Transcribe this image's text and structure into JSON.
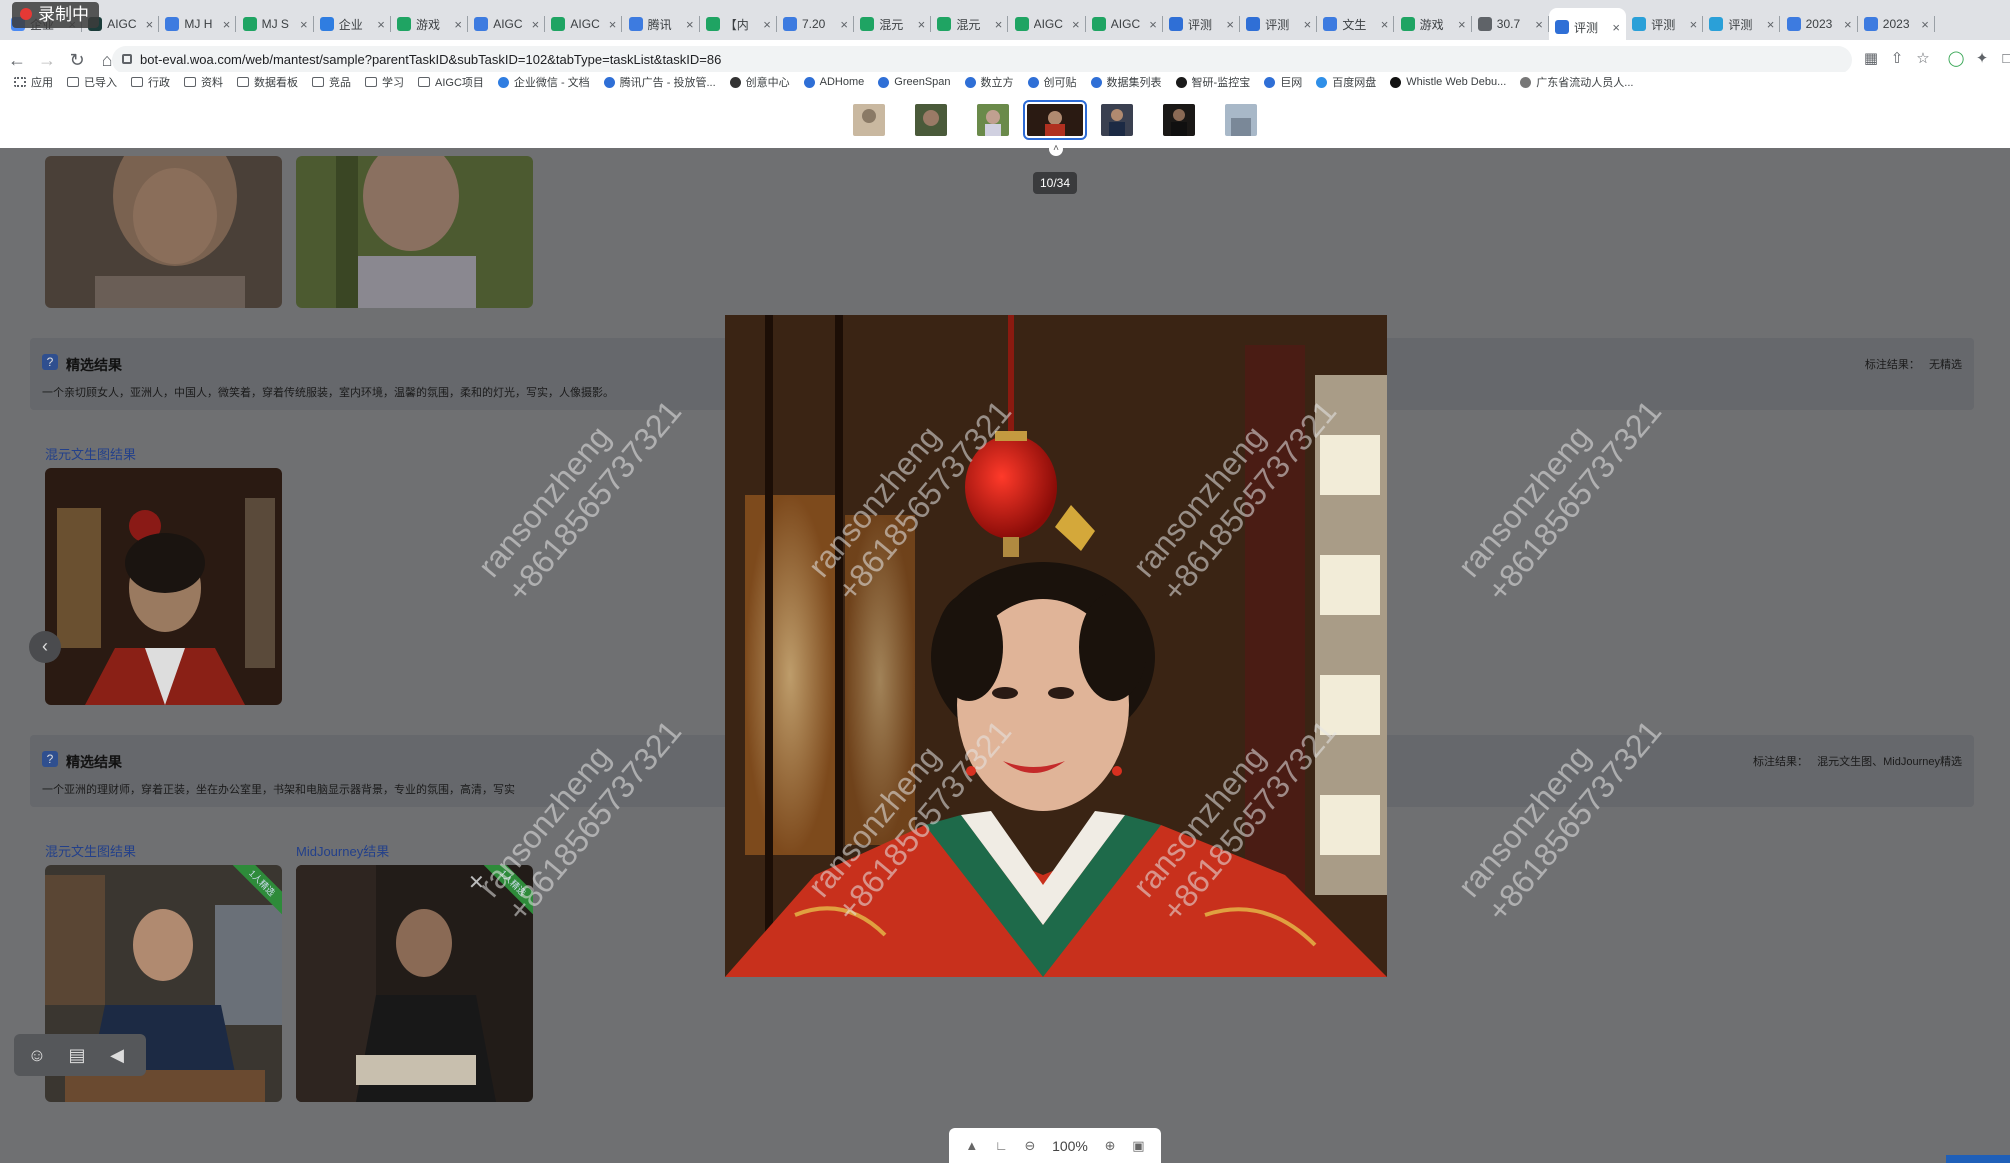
{
  "recording": {
    "label": "录制中"
  },
  "tabs": [
    {
      "label": "企业",
      "color": "#4a8af4"
    },
    {
      "label": "AIGC",
      "color": "#1b3c3a"
    },
    {
      "label": "MJ H",
      "color": "#3d7be0"
    },
    {
      "label": "MJ S",
      "color": "#1fa463"
    },
    {
      "label": "企业",
      "color": "#2f7de1"
    },
    {
      "label": "游戏",
      "color": "#1fa463"
    },
    {
      "label": "AIGC",
      "color": "#3d7be0"
    },
    {
      "label": "AIGC",
      "color": "#1fa463"
    },
    {
      "label": "腾讯",
      "color": "#3d7be0"
    },
    {
      "label": "【内",
      "color": "#1fa463"
    },
    {
      "label": "7.20",
      "color": "#3d7be0"
    },
    {
      "label": "混元",
      "color": "#1fa463"
    },
    {
      "label": "混元",
      "color": "#1fa463"
    },
    {
      "label": "AIGC",
      "color": "#1fa463"
    },
    {
      "label": "AIGC",
      "color": "#1fa463"
    },
    {
      "label": "评测",
      "color": "#2f6fd6"
    },
    {
      "label": "评测",
      "color": "#2f6fd6"
    },
    {
      "label": "文生",
      "color": "#3d7be0"
    },
    {
      "label": "游戏",
      "color": "#1fa463"
    },
    {
      "label": "30.7",
      "color": "#5f6368"
    },
    {
      "label": "评测",
      "color": "#2f6fd6",
      "active": true
    },
    {
      "label": "评测",
      "color": "#2aa0d8"
    },
    {
      "label": "评测",
      "color": "#2aa0d8"
    },
    {
      "label": "2023",
      "color": "#3d7be0"
    },
    {
      "label": "2023",
      "color": "#3d7be0"
    }
  ],
  "address": {
    "url": "bot-eval.woa.com/web/mantest/sample?parentTaskID&subTaskID=102&tabType=taskList&taskID=86"
  },
  "bookmarks": [
    {
      "label": "应用",
      "type": "apps"
    },
    {
      "label": "已导入",
      "type": "folder"
    },
    {
      "label": "行政",
      "type": "folder"
    },
    {
      "label": "资料",
      "type": "folder"
    },
    {
      "label": "数据看板",
      "type": "folder"
    },
    {
      "label": "竞品",
      "type": "folder"
    },
    {
      "label": "学习",
      "type": "folder"
    },
    {
      "label": "AIGC项目",
      "type": "folder"
    },
    {
      "label": "企业微信 - 文档",
      "type": "site",
      "color": "#2f7de1"
    },
    {
      "label": "腾讯广告 - 投放管...",
      "type": "site",
      "color": "#2f6fd6"
    },
    {
      "label": "创意中心",
      "type": "site",
      "color": "#333"
    },
    {
      "label": "ADHome",
      "type": "site",
      "color": "#2f6fd6"
    },
    {
      "label": "GreenSpan",
      "type": "site",
      "color": "#2f6fd6"
    },
    {
      "label": "数立方",
      "type": "site",
      "color": "#2f6fd6"
    },
    {
      "label": "创可贴",
      "type": "site",
      "color": "#2f6fd6"
    },
    {
      "label": "数据集列表",
      "type": "site",
      "color": "#2f6fd6"
    },
    {
      "label": "智研-监控宝",
      "type": "site",
      "color": "#1a1a1a"
    },
    {
      "label": "巨网",
      "type": "site",
      "color": "#2f6fd6"
    },
    {
      "label": "百度网盘",
      "type": "site",
      "color": "#2f8fe8"
    },
    {
      "label": "Whistle Web Debu...",
      "type": "site",
      "color": "#111"
    },
    {
      "label": "广东省流动人员人...",
      "type": "site",
      "color": "#777"
    }
  ],
  "cards": [
    {
      "icon": "?",
      "title": "精选结果",
      "description": "一个亲切顾女人，亚洲人，中国人，微笑着，穿着传统服装，室内环境，温馨的氛围，柔和的灯光，写实，人像摄影。",
      "result_label": "标注结果：",
      "result_value": "无精选"
    },
    {
      "icon": "?",
      "title": "精选结果",
      "description": "一个亚洲的理财师，穿着正装，坐在办公室里，书架和电脑显示器背景，专业的氛围，高清，写实",
      "result_label": "标注结果：",
      "result_value": "混元文生图、MidJourney精选"
    }
  ],
  "sections": {
    "hunyuan_1": "混元文生图结果",
    "hunyuan_2": "混元文生图结果",
    "midjourney_2": "MidJourney结果",
    "badge": "1人精选"
  },
  "viewer": {
    "counter": "10/34",
    "zoom": "100%",
    "watermark_name": "ransonzheng",
    "watermark_phone": "+8618565737321"
  }
}
